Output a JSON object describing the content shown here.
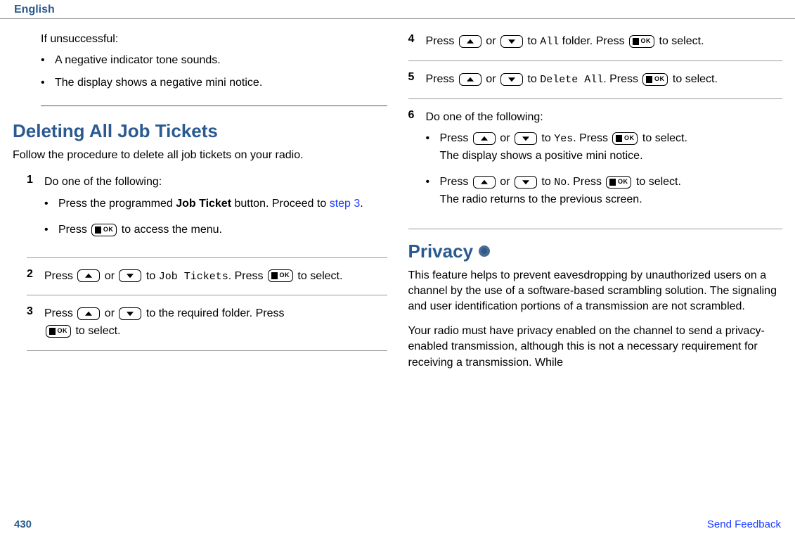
{
  "header": {
    "language": "English"
  },
  "left": {
    "unsuccessful_intro": "If unsuccessful:",
    "unsuccessful_bullets": [
      "A negative indicator tone sounds.",
      "The display shows a negative mini notice."
    ],
    "h1": "Deleting All Job Tickets",
    "subtitle": "Follow the procedure to delete all job tickets on your radio.",
    "steps": {
      "s1": {
        "num": "1",
        "text": "Do one of the following:",
        "b1_a": "Press the programmed ",
        "b1_bold": "Job Ticket",
        "b1_b": " button. Proceed to ",
        "b1_link": "step 3",
        "b1_c": ".",
        "b2_a": "Press ",
        "b2_b": " to access the menu."
      },
      "s2": {
        "num": "2",
        "a": "Press ",
        "b": " or ",
        "c": " to ",
        "mono": "Job Tickets",
        "d": ". Press ",
        "e": " to select."
      },
      "s3": {
        "num": "3",
        "a": "Press ",
        "b": " or ",
        "c": " to the required folder. Press ",
        "d": " to select."
      }
    }
  },
  "right": {
    "steps": {
      "s4": {
        "num": "4",
        "a": "Press ",
        "b": " or ",
        "c": " to ",
        "mono": "All",
        "d": " folder. Press ",
        "e": " to select."
      },
      "s5": {
        "num": "5",
        "a": "Press ",
        "b": " or ",
        "c": " to ",
        "mono": "Delete All",
        "d": ". Press ",
        "e": " to select."
      },
      "s6": {
        "num": "6",
        "text": "Do one of the following:",
        "b1_a": "Press ",
        "b1_b": " or ",
        "b1_c": " to ",
        "b1_mono": "Yes",
        "b1_d": ". Press ",
        "b1_e": " to select.",
        "b1_line2": "The display shows a positive mini notice.",
        "b2_a": "Press ",
        "b2_b": " or ",
        "b2_c": " to ",
        "b2_mono": "No",
        "b2_d": ". Press ",
        "b2_e": " to select.",
        "b2_line2": "The radio returns to the previous screen."
      }
    },
    "privacy": {
      "h1": "Privacy",
      "p1": "This feature helps to prevent eavesdropping by unauthorized users on a channel by the use of a software-based scrambling solution. The signaling and user identification portions of a transmission are not scrambled.",
      "p2": "Your radio must have privacy enabled on the channel to send a privacy-enabled transmission, although this is not a necessary requirement for receiving a transmission. While"
    }
  },
  "footer": {
    "page": "430",
    "feedback": "Send Feedback"
  }
}
